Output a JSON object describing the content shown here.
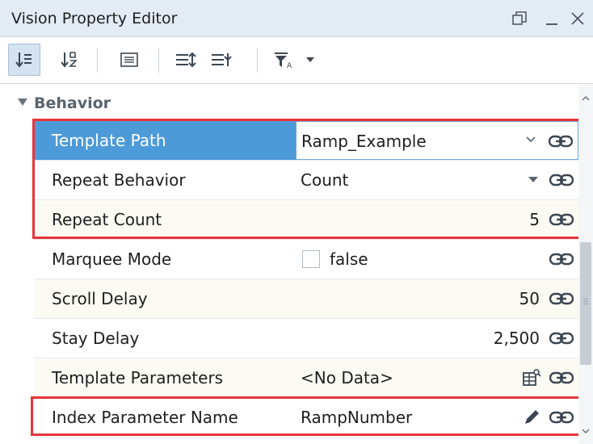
{
  "window": {
    "title": "Vision Property Editor"
  },
  "toolbar": {
    "buttons": [
      {
        "icon": "sort-categorized-icon",
        "active": true
      },
      {
        "icon": "sort-alphabetical-icon",
        "active": false
      },
      {
        "icon": "description-panel-icon",
        "active": false
      },
      {
        "icon": "expand-all-icon",
        "active": false
      },
      {
        "icon": "collapse-all-icon",
        "active": false
      },
      {
        "icon": "filter-icon",
        "active": false
      }
    ]
  },
  "group": {
    "label": "Behavior"
  },
  "properties": [
    {
      "name": "Template Path",
      "value": "Ramp_Example",
      "control": "combo"
    },
    {
      "name": "Repeat Behavior",
      "value": "Count",
      "control": "dropdown"
    },
    {
      "name": "Repeat Count",
      "value": "5",
      "control": "number"
    },
    {
      "name": "Marquee Mode",
      "value": "false",
      "control": "checkbox"
    },
    {
      "name": "Scroll Delay",
      "value": "50",
      "control": "number"
    },
    {
      "name": "Stay Delay",
      "value": "2,500",
      "control": "number"
    },
    {
      "name": "Template Parameters",
      "value": "<No Data>",
      "control": "dataset"
    },
    {
      "name": "Index Parameter Name",
      "value": "RampNumber",
      "control": "text"
    }
  ],
  "colors": {
    "highlight": "#e8343a",
    "selection": "#4d9ad8"
  }
}
